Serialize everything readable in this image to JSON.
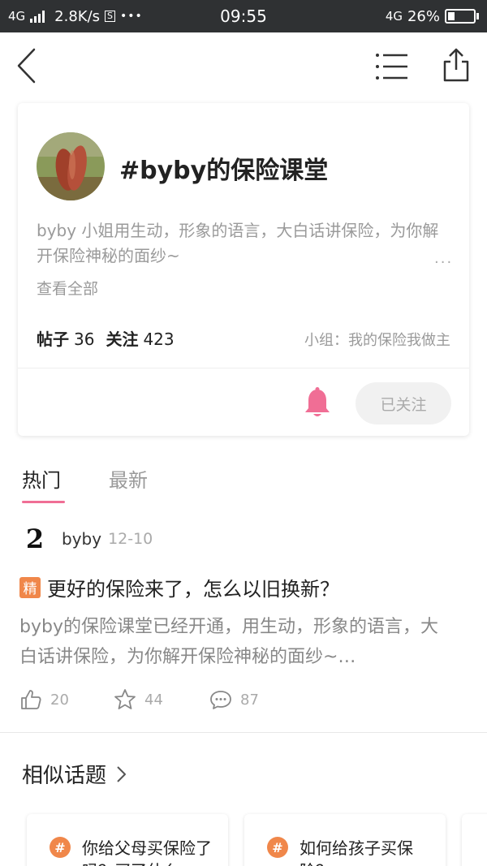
{
  "status_bar": {
    "network": "4G",
    "speed": "2.8K/s",
    "s_badge": "S",
    "more": "•••",
    "time": "09:55",
    "network_right": "4G",
    "battery": "26%"
  },
  "nav": {
    "back_icon": "chevron-left-icon",
    "menu_icon": "list-icon",
    "share_icon": "share-icon"
  },
  "topic": {
    "title": "#byby的保险课堂",
    "description": "byby 小姐用生动，形象的语言，大白话讲保险，为你解开保险神秘的面纱~",
    "ellipsis": "···",
    "view_all": "查看全部",
    "posts_label": "帖子",
    "posts_count": "36",
    "follow_label": "关注",
    "follow_count": "423",
    "group": "小组：我的保险我做主",
    "follow_button": "已关注",
    "accent_color": "#f06e95"
  },
  "tabs": [
    {
      "label": "热门",
      "active": true
    },
    {
      "label": "最新",
      "active": false
    }
  ],
  "post": {
    "avatar_char": "2",
    "author": "byby",
    "date": "12-10",
    "badge": "精",
    "title": "更好的保险来了，怎么以旧换新？",
    "excerpt": "byby的保险课堂已经开通，用生动，形象的语言，大白话讲保险，为你解开保险神秘的面纱~…",
    "likes": "20",
    "stars": "44",
    "comments": "87"
  },
  "similar": {
    "title": "相似话题",
    "items": [
      {
        "icon": "#",
        "text": "你给父母买保险了吗？买了什么"
      },
      {
        "icon": "#",
        "text": "如何给孩子买保险？"
      }
    ]
  }
}
